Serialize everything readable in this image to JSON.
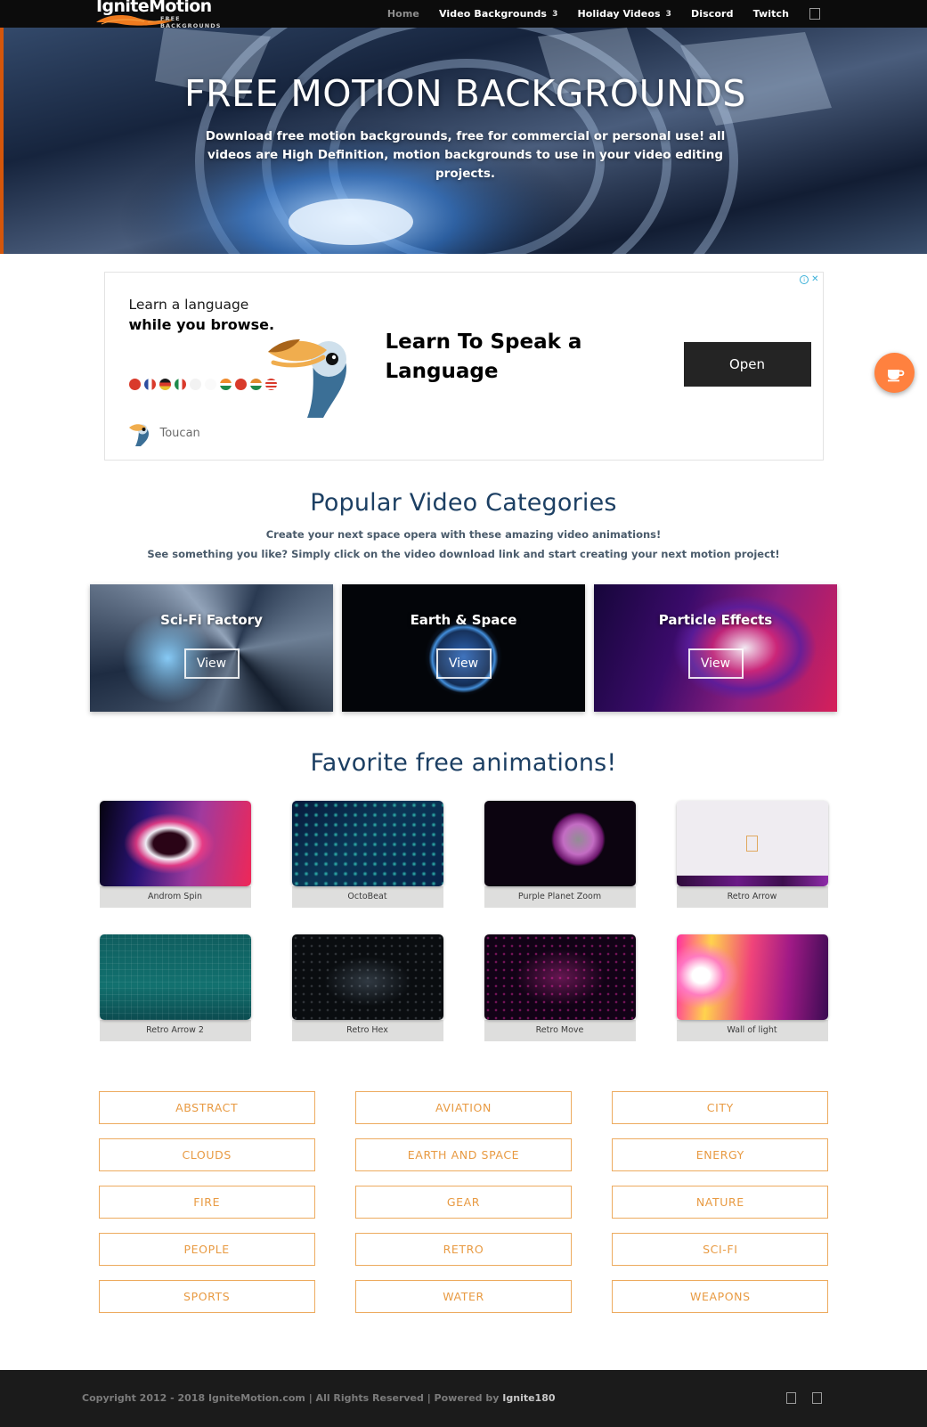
{
  "header": {
    "logo": {
      "word": "IgniteMotion",
      "tagline": "FREE BACKGROUNDS"
    },
    "nav": [
      {
        "label": "Home",
        "caret": "",
        "active": true
      },
      {
        "label": "Video Backgrounds",
        "caret": "3",
        "active": false
      },
      {
        "label": "Holiday Videos",
        "caret": "3",
        "active": false
      },
      {
        "label": "Discord",
        "caret": "",
        "active": false
      },
      {
        "label": "Twitch",
        "caret": "",
        "active": false
      }
    ],
    "search_icon": "search-icon"
  },
  "hero": {
    "title": "FREE MOTION BACKGROUNDS",
    "subtitle": "Download free motion backgrounds, free for commercial or personal use! all videos are High Definition, motion backgrounds to use in your video editing projects."
  },
  "ad": {
    "info_icon": "adchoices-info-icon",
    "close_icon": "close-icon",
    "line1": "Learn a language",
    "line2": "while you browse.",
    "headline": "Learn To Speak a Language",
    "cta": "Open",
    "brand": "Toucan",
    "flags": [
      "#d93a2b",
      "#2b4da0",
      "#1a1a1a",
      "#1f8a4c",
      "#e6e6e6",
      "#f0f0f0",
      "#ef8b2c",
      "#d93a2b",
      "#e08a2e",
      "#2b4da0"
    ]
  },
  "categories_section": {
    "title": "Popular Video Categories",
    "sub1": "Create your next space opera with these amazing video animations!",
    "sub2": "See something you like? Simply click on the video download link and start creating your next motion project!",
    "cards": [
      {
        "title": "Sci-Fi Factory",
        "view": "View",
        "art": "c1"
      },
      {
        "title": "Earth & Space",
        "view": "View",
        "art": "c2"
      },
      {
        "title": "Particle Effects",
        "view": "View",
        "art": "c3"
      }
    ]
  },
  "favorites_section": {
    "title": "Favorite free animations!",
    "items": [
      {
        "label": "Androm Spin",
        "art": "t1"
      },
      {
        "label": "OctoBeat",
        "art": "t2"
      },
      {
        "label": "Purple Planet Zoom",
        "art": "t3"
      },
      {
        "label": "Retro Arrow",
        "art": "broken"
      },
      {
        "label": "Retro Arrow 2",
        "art": "t5"
      },
      {
        "label": "Retro Hex",
        "art": "t6"
      },
      {
        "label": "Retro Move",
        "art": "t7"
      },
      {
        "label": "Wall of light",
        "art": "t8"
      }
    ]
  },
  "category_buttons": [
    "ABSTRACT",
    "AVIATION",
    "CITY",
    "CLOUDS",
    "EARTH AND SPACE",
    "ENERGY",
    "FIRE",
    "GEAR",
    "NATURE",
    "PEOPLE",
    "RETRO",
    "SCI-FI",
    "SPORTS",
    "WATER",
    "WEAPONS"
  ],
  "footer": {
    "copyright_pre": "Copyright 2012 - 2018 IgniteMotion.com | All Rights Reserved | Powered by ",
    "copyright_brand": "Ignite180",
    "icons": [
      "social-icon-1",
      "social-icon-2"
    ]
  },
  "floating": {
    "coffee_icon": "coffee-cup-icon"
  },
  "colors": {
    "accent_orange": "#e89a42",
    "brand_orange": "#ff813f",
    "heading_navy": "#1c3f63",
    "header_black": "#0c0c0c",
    "footer_black": "#1b1b1b"
  }
}
